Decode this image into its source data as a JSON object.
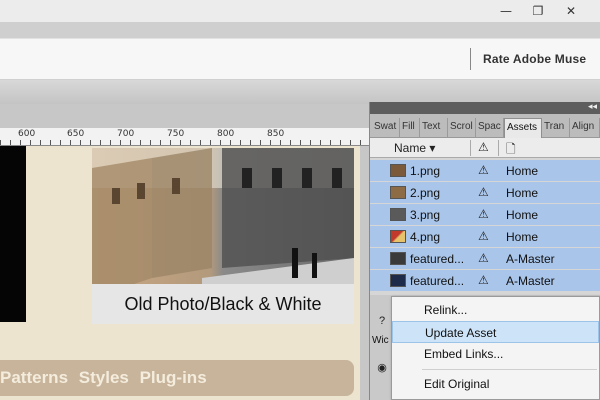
{
  "window": {
    "minimize_glyph": "—",
    "restore_glyph": "❐",
    "close_glyph": "✕"
  },
  "menubar": {
    "rate_label": "Rate Adobe Muse"
  },
  "ruler": {
    "labels": [
      "600",
      "650",
      "700",
      "750",
      "800",
      "850"
    ]
  },
  "canvas": {
    "photo_caption": "Old Photo/Black & White",
    "nav_items": [
      "Patterns",
      "Styles",
      "Plug-ins"
    ]
  },
  "panel": {
    "collapse_glyph": "◂◂",
    "tabs": [
      "Swat",
      "Fill",
      "Text",
      "Scrol",
      "Spac",
      "Assets",
      "Tran",
      "Align"
    ],
    "active_tab": "Assets",
    "column_name": "Name",
    "column_sort_glyph": "▾",
    "warning_glyph": "⚠",
    "doc_glyph": "🗋",
    "assets": [
      {
        "name": "1.png",
        "page": "Home",
        "thumb": "#7a5a3a"
      },
      {
        "name": "2.png",
        "page": "Home",
        "thumb": "#8c6b45"
      },
      {
        "name": "3.png",
        "page": "Home",
        "thumb": "#5a5a5a"
      },
      {
        "name": "4.png",
        "page": "Home",
        "thumb": "#c0392b"
      },
      {
        "name": "featured...",
        "page": "A-Master",
        "thumb": "#3a3a3a"
      },
      {
        "name": "featured...",
        "page": "A-Master",
        "thumb": "#1e2a4a"
      }
    ],
    "lower_label": "Wic"
  },
  "context_menu": {
    "items": [
      "Relink...",
      "Update Asset",
      "Embed Links...",
      "Edit Original"
    ],
    "highlighted": "Update Asset"
  }
}
